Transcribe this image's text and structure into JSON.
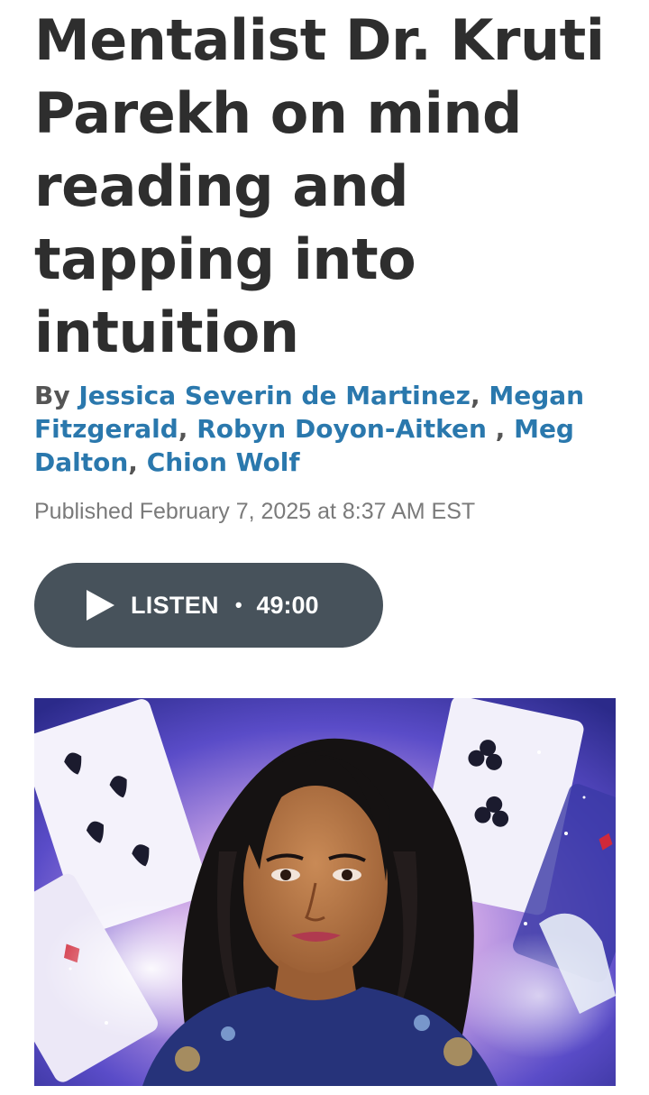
{
  "article": {
    "headline": "Mentalist Dr. Kruti Parekh on mind reading and tapping into intuition",
    "byline": {
      "prefix": "By",
      "authors": [
        {
          "name": "Jessica Severin de Martinez",
          "sep": ", "
        },
        {
          "name": "Megan Fitzgerald",
          "sep": ", "
        },
        {
          "name": "Robyn Doyon-Aitken",
          "sep": " , "
        },
        {
          "name": "Meg Dalton",
          "sep": ", "
        },
        {
          "name": "Chion Wolf",
          "sep": ""
        }
      ]
    },
    "published": "Published February 7, 2025 at 8:37 AM EST"
  },
  "audio": {
    "label": "LISTEN",
    "separator": "•",
    "duration": "49:00",
    "icon": "play-icon"
  },
  "hero_image": {
    "alt": "Portrait of Dr. Kruti Parekh with playing cards background"
  },
  "colors": {
    "headline": "#2e2e2e",
    "author_link": "#2a78ad",
    "byline_prefix": "#555555",
    "published": "#7a7a7a",
    "listen_button_bg": "#47525b"
  }
}
